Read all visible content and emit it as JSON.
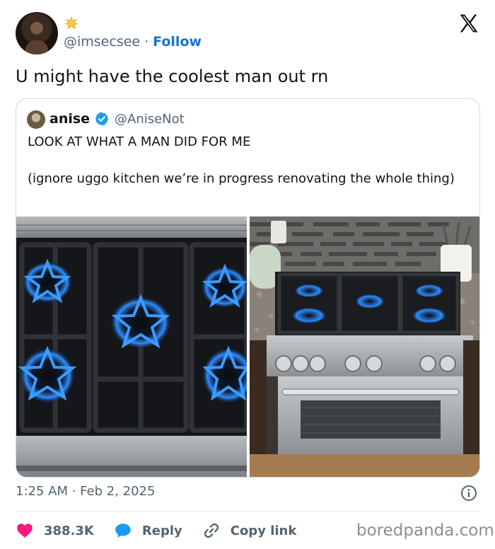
{
  "author": {
    "avatar_icon": "user-avatar",
    "badge_icon": "sun-badge-icon",
    "handle": "@imsecsee",
    "separator": "·",
    "follow_label": "Follow"
  },
  "platform_icon": "x-logo-icon",
  "tweet": {
    "text": "U might have the coolest man out rn",
    "timestamp": "1:25 AM · Feb 2, 2025"
  },
  "quote": {
    "name": "anise",
    "badge_icon": "verified-icon",
    "handle": "@AniseNot",
    "line1": "LOOK AT WHAT A MAN DID FOR ME",
    "line2": "(ignore uggo kitchen we’re in progress renovating the whole thing)",
    "images": [
      {
        "name": "stove-burners-closeup-photo"
      },
      {
        "name": "range-stove-kitchen-photo"
      }
    ]
  },
  "actions": {
    "likes": "388.3K",
    "reply_label": "Reply",
    "copy_label": "Copy link"
  },
  "watermark": "boredpanda.com",
  "colors": {
    "like": "#f91880",
    "reply": "#1d9bf0",
    "follow": "#1d73c8",
    "flame": "#2e8bff"
  }
}
